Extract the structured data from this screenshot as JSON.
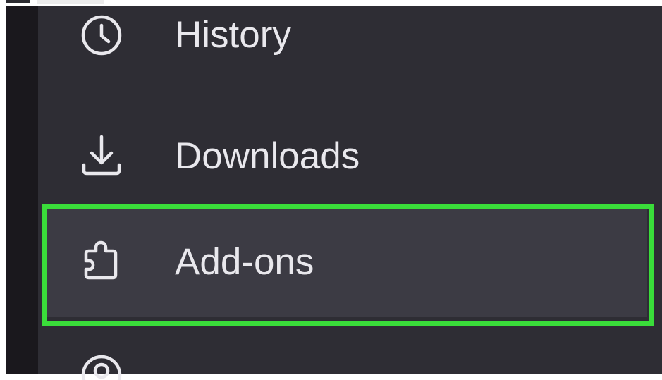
{
  "menu": {
    "items": [
      {
        "label": "History",
        "icon": "clock-icon"
      },
      {
        "label": "Downloads",
        "icon": "download-icon"
      },
      {
        "label": "Add-ons",
        "icon": "puzzle-piece-icon"
      },
      {
        "label": "",
        "icon": "account-icon"
      }
    ],
    "highlighted_item": "Add-ons"
  },
  "colors": {
    "panel_background": "#2e2d34",
    "highlighted_row_background": "#3c3b44",
    "highlight_border": "#3add3a",
    "text": "#e9e8ed"
  }
}
